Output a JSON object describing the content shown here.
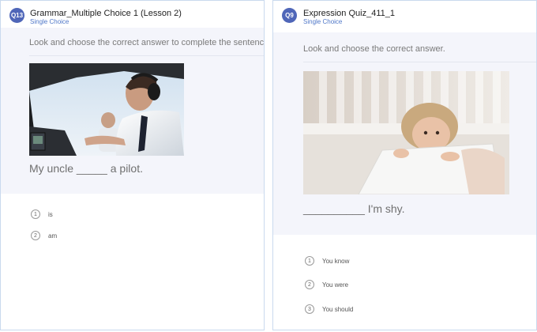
{
  "left_card": {
    "question_number": "Q13",
    "title": "Grammar_Multiple Choice 1 (Lesson 2)",
    "question_type": "Single Choice",
    "instruction": "Look and choose the correct answer to complete the sentence.",
    "sentence": "My uncle _____ a pilot.",
    "options": [
      {
        "number": "1",
        "label": "is"
      },
      {
        "number": "2",
        "label": "am"
      }
    ]
  },
  "right_card": {
    "question_number": "Q9",
    "title": "Expression Quiz_411_1",
    "question_type": "Single Choice",
    "instruction": "Look and choose the correct answer.",
    "sentence": "__________ I'm shy.",
    "options": [
      {
        "number": "1",
        "label": "You know"
      },
      {
        "number": "2",
        "label": "You were"
      },
      {
        "number": "3",
        "label": "You should"
      }
    ]
  },
  "colors": {
    "badge": "#4f66b8",
    "type_label": "#4f77c8",
    "card_border": "#c9d9ee",
    "question_bg": "#f4f5fb"
  }
}
